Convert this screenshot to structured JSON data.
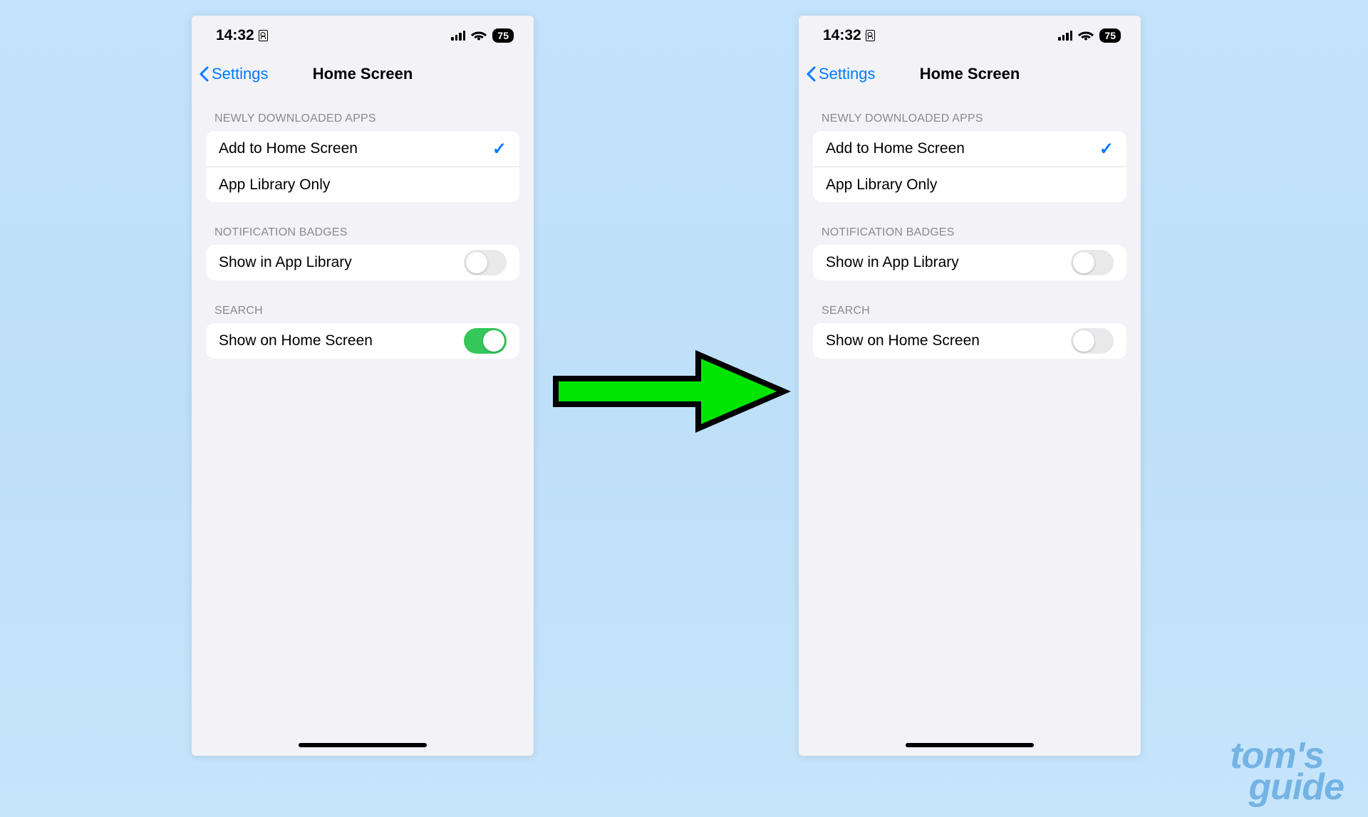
{
  "status": {
    "time": "14:32",
    "battery": "75"
  },
  "nav": {
    "back_label": "Settings",
    "title": "Home Screen"
  },
  "groups": {
    "newly_downloaded": {
      "header": "Newly Downloaded Apps",
      "add_to_home": "Add to Home Screen",
      "app_library_only": "App Library Only",
      "selected": "add_to_home"
    },
    "notification_badges": {
      "header": "Notification Badges",
      "show_in_app_library": "Show in App Library"
    },
    "search": {
      "header": "Search",
      "show_on_home": "Show on Home Screen"
    }
  },
  "screens": {
    "left": {
      "badges_toggle": false,
      "search_toggle": true
    },
    "right": {
      "badges_toggle": false,
      "search_toggle": false
    }
  },
  "watermark": {
    "line1": "tom's",
    "line2": "guide"
  }
}
